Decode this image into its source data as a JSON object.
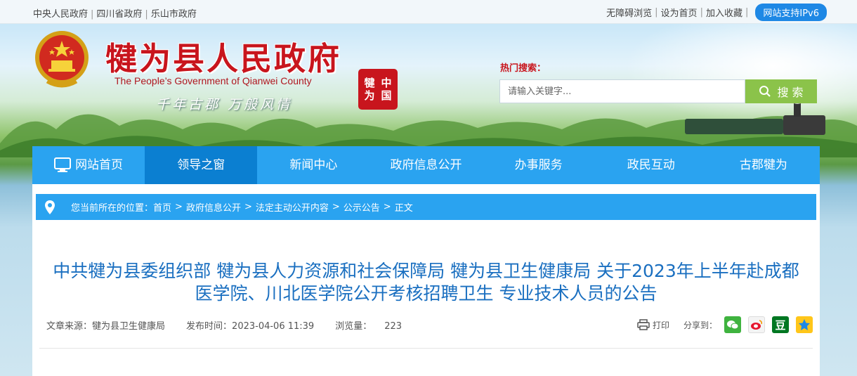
{
  "topbar": {
    "links_left": [
      "中央人民政府",
      "四川省政府",
      "乐山市政府"
    ],
    "links_right": [
      "无障碍浏览",
      "设为首页",
      "加入收藏"
    ],
    "ipv6": "网站支持IPv6"
  },
  "header": {
    "title": "犍为县人民政府",
    "subtitle": "The People’s Government of Qianwei County",
    "slogan": "千年古郡 万般风情",
    "seal_chars": [
      "中",
      "犍",
      "国",
      "为"
    ],
    "hot_search_label": "热门搜索：",
    "search_placeholder": "请输入关键字...",
    "search_button": "搜 索"
  },
  "nav": {
    "items": [
      {
        "label": "网站首页",
        "icon": "monitor-icon"
      },
      {
        "label": "领导之窗",
        "active": true
      },
      {
        "label": "新闻中心"
      },
      {
        "label": "政府信息公开"
      },
      {
        "label": "办事服务"
      },
      {
        "label": "政民互动"
      },
      {
        "label": "古郡犍为"
      }
    ]
  },
  "breadcrumb": {
    "prefix": "您当前所在的位置：",
    "items": [
      "首页",
      "政府信息公开",
      "法定主动公开内容",
      "公示公告",
      "正文"
    ],
    "separator": ">"
  },
  "article": {
    "title_line1": "中共犍为县委组织部 犍为县人力资源和社会保障局 犍为县卫生健康局 关于2023年上半年赴成都",
    "title_line2": "医学院、川北医学院公开考核招聘卫生 专业技术人员的公告",
    "source_label": "文章来源：",
    "source": "犍为县卫生健康局",
    "time_label": "发布时间：",
    "time": "2023-04-06 11:39",
    "views_label": "浏览量：",
    "views": "223",
    "print_label": "打印",
    "share_label": "分享到："
  },
  "share_icons": [
    "wechat-icon",
    "weibo-icon",
    "douban-icon",
    "qzone-icon"
  ],
  "colors": {
    "brand_red": "#c8151d",
    "nav_blue": "#2aa3f0",
    "nav_active": "#0b7fd1",
    "title_blue": "#1a6fc0",
    "search_green": "#8bc34a"
  }
}
